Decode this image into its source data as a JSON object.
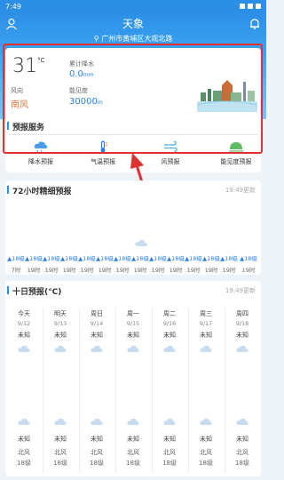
{
  "status_bar": {
    "time": "7:49"
  },
  "header": {
    "title": "天象",
    "location": "广州市黄埔区大观北路"
  },
  "current": {
    "temp": "31",
    "temp_unit": "°C",
    "rain_label": "累计降水",
    "rain_value": "0.0",
    "rain_unit": "mm",
    "wind_label": "风向",
    "wind_value": "南风",
    "visibility_label": "能见度",
    "visibility_value": "30000",
    "visibility_unit": "m"
  },
  "services": {
    "title": "预报服务",
    "items": [
      {
        "label": "降水预报",
        "icon": "cloud-rain-icon"
      },
      {
        "label": "气温预报",
        "icon": "thermometer-icon"
      },
      {
        "label": "风预报",
        "icon": "wind-icon"
      },
      {
        "label": "能见度预报",
        "icon": "visibility-icon"
      }
    ]
  },
  "hourly": {
    "title": "72小时精细预报",
    "updated": "19:49更新",
    "items": [
      {
        "wind": "18级",
        "time": "7时"
      },
      {
        "wind": "18级",
        "time": "19时"
      },
      {
        "wind": "18级",
        "time": "19时"
      },
      {
        "wind": "18级",
        "time": "19时"
      },
      {
        "wind": "18级",
        "time": "19时"
      },
      {
        "wind": "18级",
        "time": "19时"
      },
      {
        "wind": "18级",
        "time": "19时"
      },
      {
        "wind": "18级",
        "time": "19时"
      },
      {
        "wind": "18级",
        "time": "19时"
      },
      {
        "wind": "18级",
        "time": "19时"
      },
      {
        "wind": "18级",
        "time": "19时"
      },
      {
        "wind": "18级",
        "time": "19时"
      },
      {
        "wind": "18级",
        "time": "19时"
      },
      {
        "wind": "18级",
        "time": "19时"
      }
    ]
  },
  "tenday": {
    "title": "十日预报(°C)",
    "updated": "19:49更新",
    "days": [
      {
        "name": "今天",
        "date": "9/12",
        "high": "未知",
        "low": "未知",
        "wind_dir": "北风",
        "wind_level": "18级"
      },
      {
        "name": "明天",
        "date": "9/13",
        "high": "未知",
        "low": "未知",
        "wind_dir": "北风",
        "wind_level": "18级"
      },
      {
        "name": "周日",
        "date": "9/14",
        "high": "未知",
        "low": "未知",
        "wind_dir": "北风",
        "wind_level": "18级"
      },
      {
        "name": "周一",
        "date": "9/15",
        "high": "未知",
        "low": "未知",
        "wind_dir": "北风",
        "wind_level": "18级"
      },
      {
        "name": "周二",
        "date": "9/16",
        "high": "未知",
        "low": "未知",
        "wind_dir": "北风",
        "wind_level": "18级"
      },
      {
        "name": "周三",
        "date": "9/17",
        "high": "未知",
        "low": "未知",
        "wind_dir": "北风",
        "wind_level": "18级"
      },
      {
        "name": "周四",
        "date": "9/18",
        "high": "未知",
        "low": "未知",
        "wind_dir": "北风",
        "wind_level": "18级"
      }
    ]
  },
  "colors": {
    "primary": "#2c8fe6",
    "highlight": "#e03030",
    "wind_accent": "#e8743b"
  }
}
